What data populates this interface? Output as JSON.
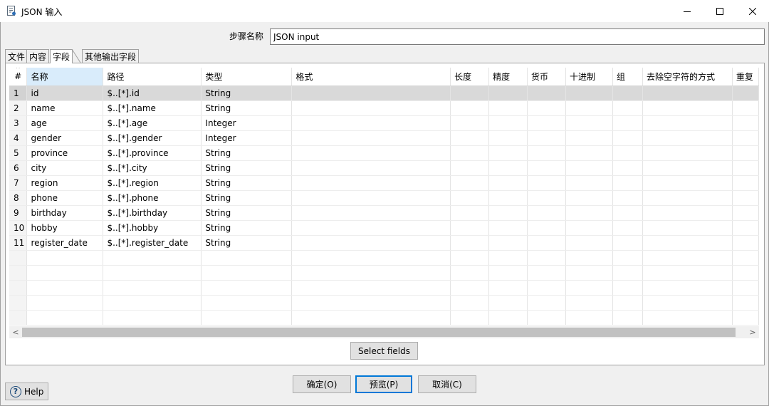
{
  "window": {
    "title": "JSON 输入",
    "icon": "json-input-icon",
    "minimize_glyph": "—",
    "maximize_glyph": "☐",
    "close_glyph": "✕"
  },
  "step": {
    "label": "步骤名称",
    "value": "JSON input"
  },
  "tabs": [
    {
      "label": "文件",
      "active": false
    },
    {
      "label": "内容",
      "active": false
    },
    {
      "label": "字段",
      "active": true
    },
    {
      "label": "其他输出字段",
      "active": false
    }
  ],
  "grid": {
    "columns": [
      "#",
      "名称",
      "路径",
      "类型",
      "格式",
      "长度",
      "精度",
      "货币",
      "十进制",
      "组",
      "去除空字符的方式",
      "重复"
    ],
    "sort_indicator": "^",
    "rows": [
      {
        "num": "1",
        "name": "id",
        "path": "$..[*].id",
        "type": "String"
      },
      {
        "num": "2",
        "name": "name",
        "path": "$..[*].name",
        "type": "String"
      },
      {
        "num": "3",
        "name": "age",
        "path": "$..[*].age",
        "type": "Integer"
      },
      {
        "num": "4",
        "name": "gender",
        "path": "$..[*].gender",
        "type": "Integer"
      },
      {
        "num": "5",
        "name": "province",
        "path": "$..[*].province",
        "type": "String"
      },
      {
        "num": "6",
        "name": "city",
        "path": "$..[*].city",
        "type": "String"
      },
      {
        "num": "7",
        "name": "region",
        "path": "$..[*].region",
        "type": "String"
      },
      {
        "num": "8",
        "name": "phone",
        "path": "$..[*].phone",
        "type": "String"
      },
      {
        "num": "9",
        "name": "birthday",
        "path": "$..[*].birthday",
        "type": "String"
      },
      {
        "num": "10",
        "name": "hobby",
        "path": "$..[*].hobby",
        "type": "String"
      },
      {
        "num": "11",
        "name": "register_date",
        "path": "$..[*].register_date",
        "type": "String"
      }
    ]
  },
  "scroll": {
    "left_arrow": "<",
    "right_arrow": ">"
  },
  "buttons": {
    "select_fields": "Select fields",
    "ok": "确定(O)",
    "preview": "预览(P)",
    "cancel": "取消(C)",
    "help": "Help",
    "help_glyph": "?"
  }
}
